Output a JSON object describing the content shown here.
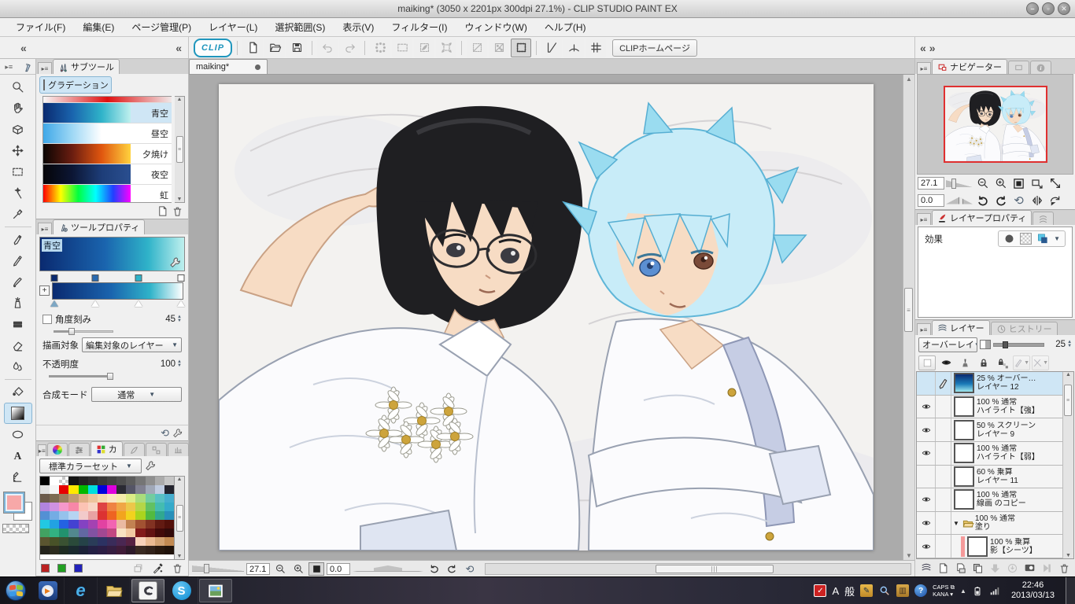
{
  "window": {
    "title": "maiking* (3050 x 2201px 300dpi 27.1%)  - CLIP STUDIO PAINT EX",
    "minimize_glyph": "–",
    "maximize_glyph": "▫",
    "close_glyph": "✕"
  },
  "menubar": {
    "items": [
      "ファイル(F)",
      "編集(E)",
      "ページ管理(P)",
      "レイヤー(L)",
      "選択範囲(S)",
      "表示(V)",
      "フィルター(I)",
      "ウィンドウ(W)",
      "ヘルプ(H)"
    ]
  },
  "toolbar": {
    "clip_logo": "CLIP",
    "home_button": "CLIPホームページ",
    "buttons": [
      {
        "icon": "new-page-icon",
        "state": "normal"
      },
      {
        "icon": "open-folder-icon",
        "state": "normal"
      },
      {
        "icon": "save-icon",
        "state": "normal"
      },
      {
        "sep": true
      },
      {
        "icon": "undo-icon",
        "state": "disabled"
      },
      {
        "icon": "redo-icon",
        "state": "disabled"
      },
      {
        "sep": true
      },
      {
        "icon": "deselect-icon",
        "state": "disabled"
      },
      {
        "icon": "marquee-icon",
        "state": "disabled"
      },
      {
        "icon": "quick-mask-icon",
        "state": "disabled"
      },
      {
        "icon": "transform-icon",
        "state": "disabled"
      },
      {
        "sep": true
      },
      {
        "icon": "no-border-icon",
        "state": "disabled"
      },
      {
        "icon": "tone-area-icon",
        "state": "disabled"
      },
      {
        "icon": "selection-border-icon",
        "state": "active"
      },
      {
        "sep": true
      },
      {
        "icon": "snap-ruler-icon",
        "state": "blue"
      },
      {
        "icon": "snap-special-icon",
        "state": "blue"
      },
      {
        "icon": "snap-grid-icon",
        "state": "blue"
      }
    ]
  },
  "document": {
    "tab_label": "maiking*"
  },
  "tool_strip": {
    "tools": [
      {
        "icon": "magnifier-icon"
      },
      {
        "icon": "hand-icon"
      },
      {
        "icon": "operation-icon"
      },
      {
        "icon": "move-icon"
      },
      {
        "icon": "marquee-icon"
      },
      {
        "icon": "wand-icon"
      },
      {
        "icon": "dropper-icon"
      },
      {
        "div": true
      },
      {
        "icon": "pen-icon"
      },
      {
        "icon": "pencil-icon"
      },
      {
        "icon": "brush-icon"
      },
      {
        "icon": "airbrush-icon"
      },
      {
        "icon": "decoration-icon"
      },
      {
        "icon": "eraser-icon"
      },
      {
        "icon": "blend-icon"
      },
      {
        "div": true
      },
      {
        "icon": "fill-icon"
      },
      {
        "icon": "gradient-icon",
        "selected": true
      },
      {
        "icon": "figure-icon"
      },
      {
        "icon": "text-icon"
      },
      {
        "icon": "ruler-icon"
      }
    ]
  },
  "subtool_panel": {
    "tab": "サブツール",
    "group_button": "グラデーション",
    "items": [
      {
        "label": "青空",
        "selected": true,
        "gradient": [
          "#0a2a70",
          "#1a64ae",
          "#2fb3c9",
          "#bff0ee"
        ]
      },
      {
        "label": "昼空",
        "selected": false,
        "gradient": [
          "#3fa8e8",
          "#9fd8f5",
          "#ffffff",
          "#ffffff"
        ]
      },
      {
        "label": "夕焼け",
        "selected": false,
        "gradient": [
          "#0a0503",
          "#6b1d10",
          "#e0560f",
          "#ffd23e"
        ]
      },
      {
        "label": "夜空",
        "selected": false,
        "gradient": [
          "#050508",
          "#0c1634",
          "#1d3d78",
          "#2a4f90"
        ]
      },
      {
        "label": "虹",
        "selected": false,
        "gradient": [
          "#ff0000",
          "#ffff00",
          "#00ff40",
          "#00ffff",
          "#2040ff",
          "#ff00ff"
        ]
      }
    ],
    "partial_gradient": [
      "#f8f8f8",
      "#e01010",
      "#f0e8e8"
    ]
  },
  "tool_property_panel": {
    "tab": "ツールプロパティ",
    "preset_name": "青空",
    "stops": [
      "#0a2a70",
      "#2a6ab0",
      "#2fb3c9",
      "#ffffff"
    ],
    "stop_positions": [
      2,
      33,
      66,
      98
    ],
    "angle_label": "角度刻み",
    "angle_value": "45",
    "target_label": "描画対象",
    "target_value": "編集対象のレイヤー",
    "opacity_label": "不透明度",
    "opacity_value": "100",
    "blend_label": "合成モード",
    "blend_value": "通常"
  },
  "color_panel": {
    "tab_short": "カ",
    "set_name": "標準カラーセット",
    "rows": [
      [
        "#000000",
        "#ffffff",
        "CHK",
        "#141414",
        "#232323",
        "#2d2d2d",
        "#383838",
        "#424242",
        "#4d4d4d",
        "#5c5c5c",
        "#757575",
        "#8f8f8f",
        "#ababab",
        "#c6c6c6"
      ],
      [
        "#e0e0e0",
        "#f5f5f5",
        "#e60000",
        "#ffe800",
        "#00b800",
        "#00dddd",
        "#0000dd",
        "#dd00dd",
        "#2a2a33",
        "#555566",
        "#808090",
        "#a0a8b8",
        "#bfcbe0",
        "#24242e"
      ],
      [
        "#6b5a4a",
        "#7d6b52",
        "#9c7e5e",
        "#c09a74",
        "#e0b088",
        "#eec49c",
        "#f6d6ae",
        "#fae4c2",
        "#f4ecaa",
        "#dcec86",
        "#aadc7c",
        "#72cca0",
        "#58c0c4",
        "#46aece"
      ],
      [
        "#b184de",
        "#cf92e2",
        "#f598cb",
        "#f787a8",
        "#fcc3b4",
        "#f8d5c5",
        "#de4343",
        "#ef8243",
        "#f0a646",
        "#ecc74a",
        "#b4d648",
        "#62c162",
        "#44bcb0",
        "#35aaca"
      ],
      [
        "#5490d4",
        "#74ace4",
        "#96c2ec",
        "#b6d4f2",
        "#f2caca",
        "#e8a2a2",
        "#dc3232",
        "#ee6422",
        "#f2a41e",
        "#f2d21e",
        "#aad41e",
        "#52ba40",
        "#30a890",
        "#2890ba"
      ],
      [
        "#22c8e2",
        "#22a2e2",
        "#2462e2",
        "#4442d2",
        "#8442c2",
        "#a442b2",
        "#e242a2",
        "#f264b2",
        "#eabaa2",
        "#c28252",
        "#a25232",
        "#823222",
        "#621a12",
        "#52100a"
      ],
      [
        "#42a262",
        "#32b282",
        "#22926e",
        "#52888e",
        "#6268a2",
        "#8252a2",
        "#a24892",
        "#c24882",
        "#f8e2c2",
        "#f2caa2",
        "#821a1a",
        "#621212",
        "#420a0a",
        "#320a0a"
      ],
      [
        "#5a5530",
        "#485228",
        "#3a5232",
        "#2a4a3a",
        "#254248",
        "#2a3c58",
        "#2c3262",
        "#3a2c5a",
        "#4a2752",
        "#572242",
        "#f8d2ba",
        "#eaba92",
        "#d2a272",
        "#c28a52"
      ],
      [
        "#24241c",
        "#2c2c1e",
        "#1e2c22",
        "#1a2a2e",
        "#1c2238",
        "#242044",
        "#2c1e44",
        "#361e40",
        "#401c38",
        "#2e1a2a",
        "#3a2a22",
        "#32221a",
        "#28180e",
        "#20120a"
      ]
    ],
    "history_swatches": [
      "#bb2222",
      "#22a022",
      "#2222bb"
    ]
  },
  "navigator": {
    "tab": "ナビゲーター",
    "zoom_value": "27.1",
    "rotate_value": "0.0"
  },
  "layer_property_panel": {
    "tab": "レイヤープロパティ",
    "effect_label": "効果"
  },
  "layer_panel": {
    "tab": "レイヤー",
    "tab_history": "ヒストリー",
    "blend_mode": "オーバーレイ",
    "opacity_value": "25",
    "layers": [
      {
        "line1": "25 % オーバー…",
        "line2": "レイヤー 12",
        "visible": false,
        "selected": true,
        "editing": true,
        "thumb": "grad"
      },
      {
        "line1": "100 % 通常",
        "line2": "ハイライト【強】",
        "visible": true,
        "thumb": "chk"
      },
      {
        "line1": "50 % スクリーン",
        "line2": "レイヤー 9",
        "visible": true,
        "thumb": "chk"
      },
      {
        "line1": "100 % 通常",
        "line2": "ハイライト【弱】",
        "visible": true,
        "thumb": "chk"
      },
      {
        "line1": "60 % 乗算",
        "line2": "レイヤー 11",
        "visible": false,
        "thumb": "chk"
      },
      {
        "line1": "100 % 通常",
        "line2": "線画 のコピー",
        "visible": true,
        "thumb": "chk"
      },
      {
        "line1": "100 % 通常",
        "line2": "塗り",
        "visible": true,
        "thumb": "folder",
        "folder": true
      },
      {
        "line1": "100 % 乗算",
        "line2": "影【シーツ】",
        "visible": true,
        "thumb": "chk",
        "indent": true,
        "colorbar": true
      }
    ]
  },
  "status_bar": {
    "zoom_value": "27.1",
    "rotate_value": "0.0"
  },
  "taskbar": {
    "apps": [
      {
        "name": "start-button",
        "kind": "start"
      },
      {
        "name": "media-player-button",
        "kind": "wmp"
      },
      {
        "name": "internet-explorer-button",
        "kind": "ie"
      },
      {
        "name": "explorer-button",
        "kind": "explorer"
      },
      {
        "name": "clip-studio-button",
        "kind": "clip",
        "active": true
      },
      {
        "name": "skype-button",
        "kind": "skype"
      },
      {
        "name": "image-viewer-button",
        "kind": "viewer",
        "open": true
      }
    ],
    "ime_a": "A",
    "ime_gen": "般",
    "caps": "CAPS",
    "kana": "KANA",
    "clock_time": "22:46",
    "clock_date": "2013/03/13"
  }
}
